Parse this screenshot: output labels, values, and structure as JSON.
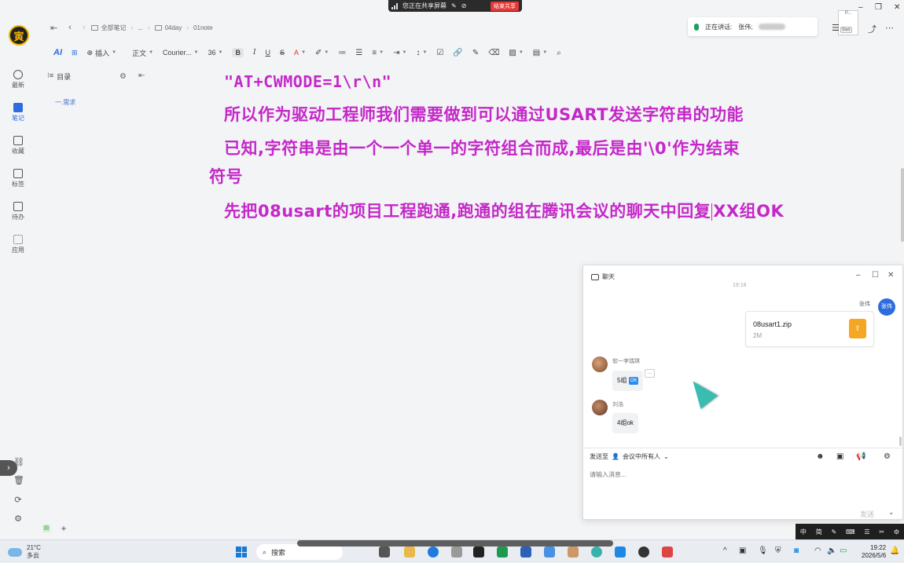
{
  "share_bar": {
    "status": "您正在共享屏幕",
    "end_label": "结束共享"
  },
  "app_nav": [
    {
      "label": "最新",
      "icon": "clock-icon"
    },
    {
      "label": "笔记",
      "icon": "note-icon"
    },
    {
      "label": "收藏",
      "icon": "bookmark-icon"
    },
    {
      "label": "标签",
      "icon": "tag-icon"
    },
    {
      "label": "待办",
      "icon": "todo-icon"
    },
    {
      "label": "应用",
      "icon": "apps-icon"
    }
  ],
  "breadcrumb": {
    "root": "全部笔记",
    "ellipsis": "...",
    "folder": "04day",
    "note": "01note"
  },
  "speaking": {
    "label": "正在讲话:",
    "name": "张伟;"
  },
  "start_thumb": {
    "title": "P...",
    "tag": "Start"
  },
  "toolbar": {
    "ai": "AI",
    "insert": "插入",
    "style": "正文",
    "font": "Courier...",
    "size": "36",
    "bold": "B",
    "italic": "I",
    "underline": "U",
    "strike": "S",
    "font_color": "A"
  },
  "toc": {
    "title": "目录",
    "entries": [
      "一.需求"
    ]
  },
  "document": {
    "line1": "\"AT+CWMODE=1\\r\\n\"",
    "line2": "所以作为驱动工程师我们需要做到可以通过USART发送字符串的功能",
    "line3a": "已知,字符串是由一个一个单一的字符组合而成,最后是由'\\0'作为结束",
    "line3b": "符号",
    "line4a": "先把08usart的项目工程跑通,跑通的组在腾讯会议的聊天中回复",
    "line4b": "XX组OK"
  },
  "chat": {
    "title": "聊天",
    "time": "19:18",
    "self_name": "张伟",
    "self_avatar": "张伟",
    "file_name": "08usart1.zip",
    "file_size": "2M",
    "messages": [
      {
        "sender": "软一李瑞琪",
        "text": "5组",
        "badge": "OK"
      },
      {
        "sender": "刘浩",
        "text": "4组ok"
      }
    ],
    "send_to_label": "发送至",
    "send_to_target": "会议中所有人",
    "input_placeholder": "请输入消息...",
    "send_label": "发送"
  },
  "ime": [
    "中",
    "简"
  ],
  "taskbar": {
    "temp": "21°C",
    "weather": "多云",
    "search": "搜索",
    "time": "19:22",
    "date": "2026/5/6"
  },
  "colors": {
    "doc_text": "#c428c8",
    "accent": "#2d6cdf"
  }
}
